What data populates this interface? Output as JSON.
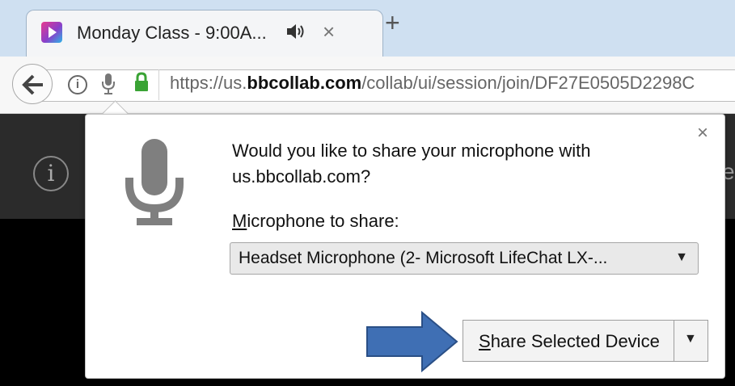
{
  "tab": {
    "title": "Monday Class - 9:00A...",
    "audio_icon": "speaker-icon",
    "close_glyph": "×"
  },
  "newtab": {
    "glyph": "+"
  },
  "navbar": {
    "url_prefix": "https://us.",
    "url_domain": "bbcollab.com",
    "url_path": "/collab/ui/session/join/DF27E0505D2298C",
    "info_glyph": "i"
  },
  "page": {
    "info_glyph": "i",
    "partial_text": "e"
  },
  "popup": {
    "prompt": "Would you like to share your microphone with us.bbcollab.com?",
    "close_glyph": "×",
    "mic_label_accesskey": "M",
    "mic_label_rest": "icrophone to share:",
    "selected_device": "Headset Microphone (2- Microsoft LifeChat LX-...",
    "share_accesskey": "S",
    "share_rest": "hare Selected Device"
  },
  "colors": {
    "tabstrip": "#cfe0f1",
    "lock": "#3aa335",
    "annotation_arrow": "#3f6fb4"
  }
}
